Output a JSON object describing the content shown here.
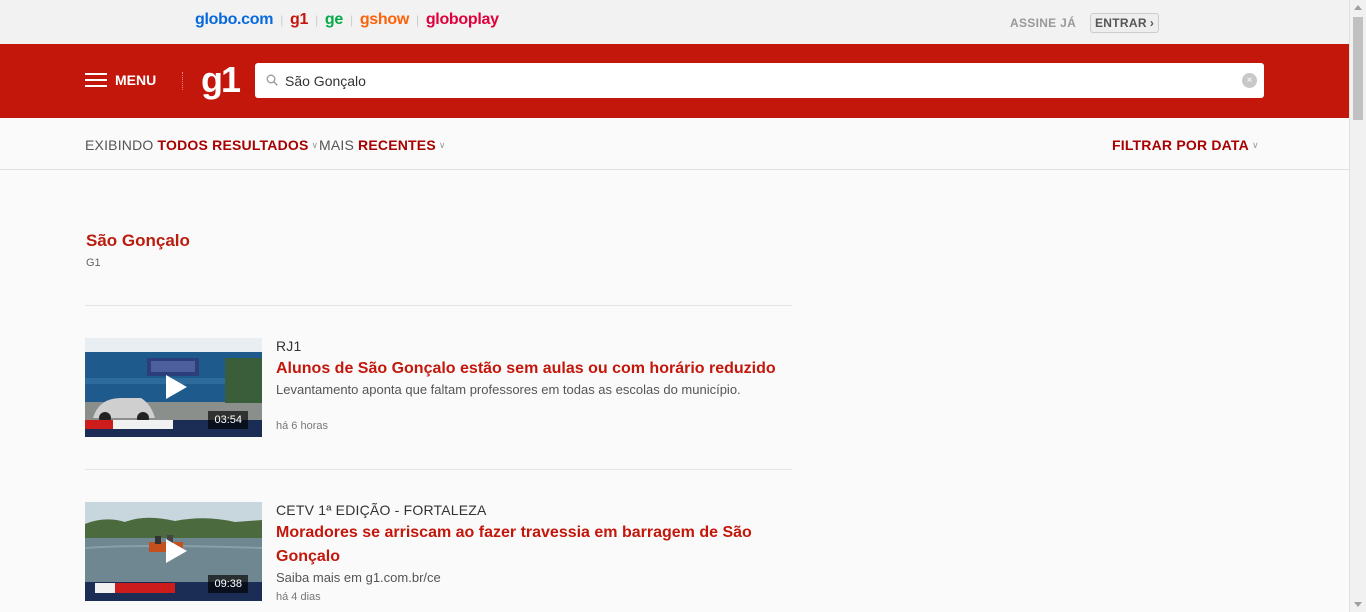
{
  "topbar": {
    "brands": [
      "globo.com",
      "g1",
      "ge",
      "gshow",
      "globoplay"
    ],
    "assine": "ASSINE JÁ",
    "entrar": "ENTRAR",
    "entrar_arrow": "›"
  },
  "header": {
    "menu_label": "MENU",
    "logo": "g1",
    "search_value": "São Gonçalo",
    "clear_icon": "×"
  },
  "filters": {
    "exibindo_prefix": "EXIBINDO",
    "exibindo_value": "TODOS RESULTADOS",
    "mais_prefix": "MAIS",
    "mais_value": "RECENTES",
    "filtrar": "FILTRAR POR DATA",
    "chevron": "∨"
  },
  "topic": {
    "title": "São Gonçalo",
    "source": "G1"
  },
  "results": [
    {
      "section": "RJ1",
      "headline": "Alunos de São Gonçalo estão sem aulas ou com horário reduzido",
      "description": "Levantamento aponta que faltam professores em todas as escolas do município.",
      "time": "há 6 horas",
      "duration": "03:54"
    },
    {
      "section": "CETV 1ª EDIÇÃO - FORTALEZA",
      "headline": "Moradores se arriscam ao fazer travessia em barragem de São Gonçalo",
      "description": "Saiba mais em g1.com.br/ce",
      "time": "há 4 dias",
      "duration": "09:38"
    }
  ],
  "colors": {
    "brand_red": "#c4170c",
    "headline_red": "#c4170c",
    "filter_red": "#a80000"
  }
}
